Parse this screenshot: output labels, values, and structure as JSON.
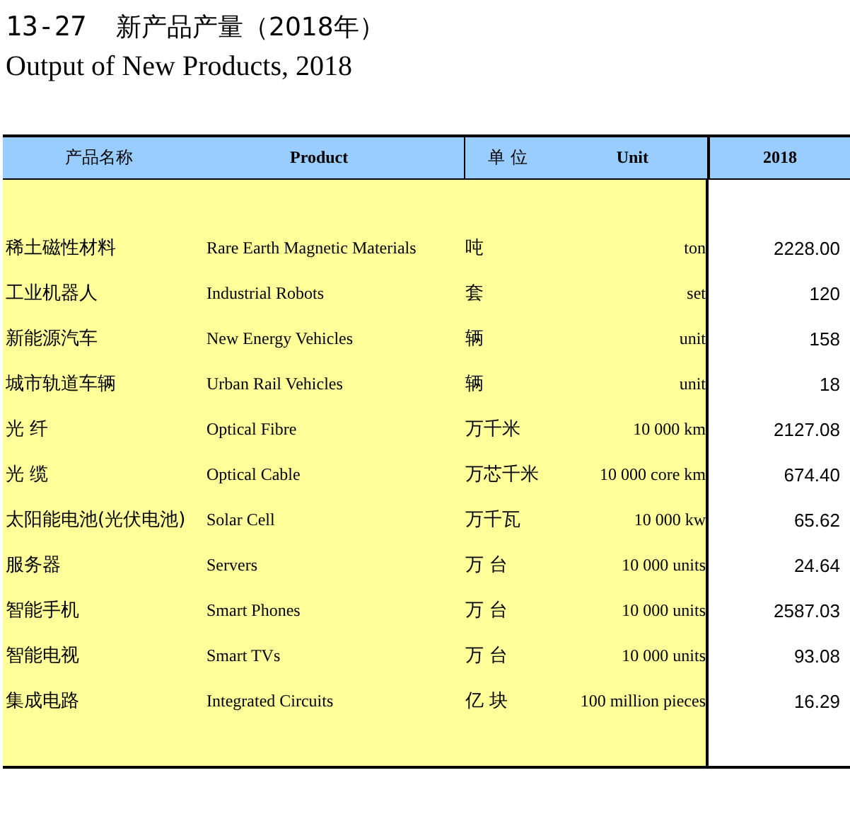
{
  "title": {
    "number": "13-27",
    "chinese": "新产品产量（2018年）",
    "english": "Output of New Products, 2018"
  },
  "table": {
    "columns": [
      {
        "chinese": "产品名称",
        "english": "Product"
      },
      {
        "chinese": "单 位",
        "english": "Unit"
      },
      {
        "english": "2018"
      }
    ],
    "rows": [
      {
        "product_cn": "稀土磁性材料",
        "product_en": "Rare Earth Magnetic Materials",
        "unit_cn": "吨",
        "unit_en": "ton",
        "value": "2228.00"
      },
      {
        "product_cn": "工业机器人",
        "product_en": "Industrial Robots",
        "unit_cn": "套",
        "unit_en": "set",
        "value": "120"
      },
      {
        "product_cn": "新能源汽车",
        "product_en": "New Energy Vehicles",
        "unit_cn": "辆",
        "unit_en": "unit",
        "value": "158"
      },
      {
        "product_cn": "城市轨道车辆",
        "product_en": "Urban Rail Vehicles",
        "unit_cn": "辆",
        "unit_en": "unit",
        "value": "18"
      },
      {
        "product_cn": "光 纤",
        "product_en": "Optical Fibre",
        "unit_cn": "万千米",
        "unit_en": "10 000 km",
        "value": "2127.08"
      },
      {
        "product_cn": "光 缆",
        "product_en": "Optical Cable",
        "unit_cn": "万芯千米",
        "unit_en": "10 000 core km",
        "value": "674.40"
      },
      {
        "product_cn": "太阳能电池(光伏电池)",
        "product_en": "Solar Cell",
        "unit_cn": "万千瓦",
        "unit_en": "10 000 kw",
        "value": "65.62"
      },
      {
        "product_cn": "服务器",
        "product_en": "Servers",
        "unit_cn": "万 台",
        "unit_en": "10 000 units",
        "value": "24.64"
      },
      {
        "product_cn": "智能手机",
        "product_en": "Smart Phones",
        "unit_cn": "万 台",
        "unit_en": "10 000 units",
        "value": "2587.03"
      },
      {
        "product_cn": "智能电视",
        "product_en": "Smart TVs",
        "unit_cn": "万 台",
        "unit_en": "10 000 units",
        "value": "93.08"
      },
      {
        "product_cn": "集成电路",
        "product_en": "Integrated Circuits",
        "unit_cn": "亿 块",
        "unit_en": "100 million pieces",
        "value": "16.29"
      }
    ]
  }
}
